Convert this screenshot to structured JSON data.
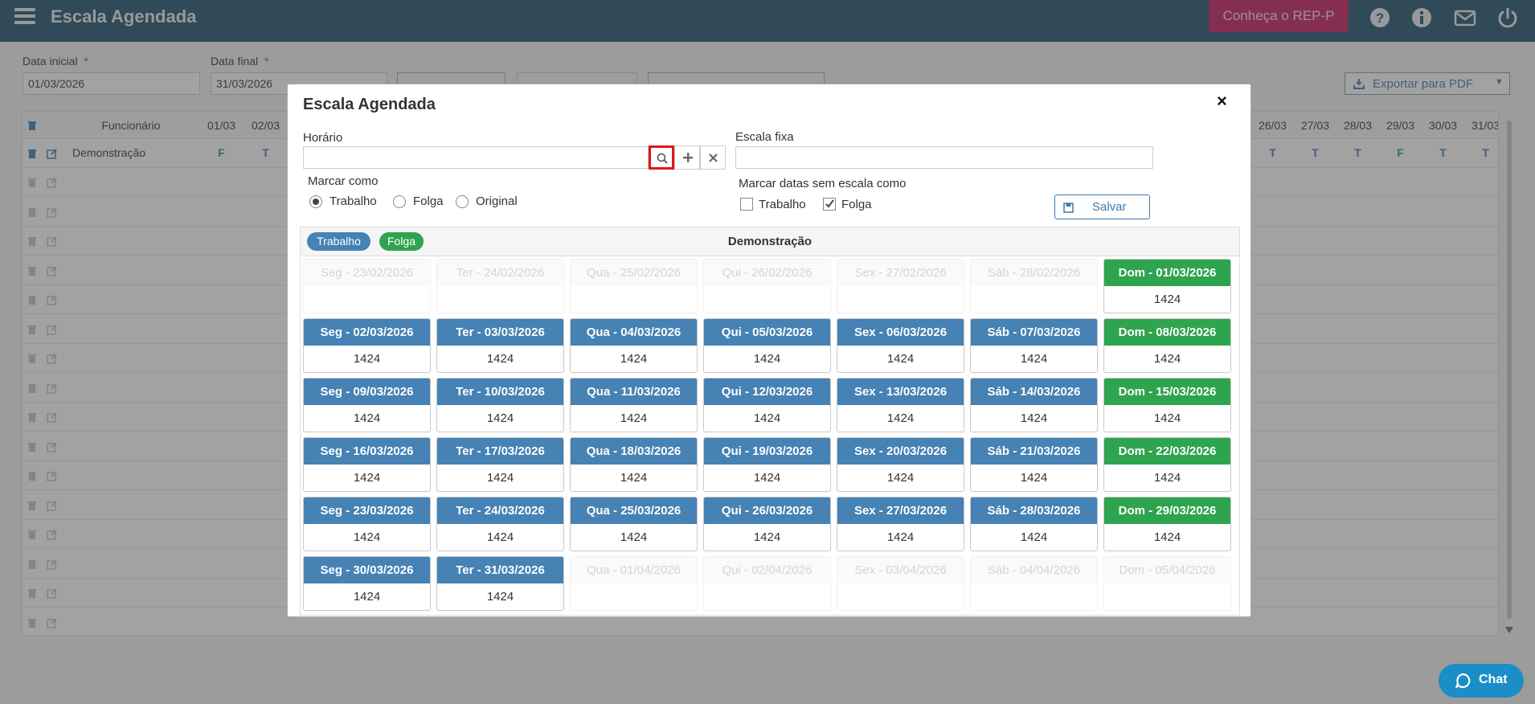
{
  "app": {
    "title": "Escala Agendada",
    "rep_button": "Conheça o REP-P"
  },
  "filters": {
    "start_label": "Data inicial",
    "start_value": "01/03/2026",
    "end_label": "Data final",
    "end_value": "31/03/2026",
    "required_mark": "*",
    "export_label": "Exportar para PDF"
  },
  "grid": {
    "header": {
      "employee": "Funcionário",
      "dates_left": [
        "01/03",
        "02/03"
      ],
      "dates_right": [
        "26/03",
        "27/03",
        "28/03",
        "29/03",
        "30/03",
        "31/03"
      ]
    },
    "row": {
      "employee": "Demonstração",
      "marks_left": [
        "F",
        "T"
      ],
      "marks_right": [
        "T",
        "T",
        "T",
        "F",
        "T",
        "T"
      ]
    }
  },
  "modal": {
    "title": "Escala Agendada",
    "close": "×",
    "horario_label": "Horário",
    "horario_value": "",
    "escala_fixa_label": "Escala fixa",
    "escala_fixa_value": "",
    "marcar_como_label": "Marcar como",
    "marcar_como_options": [
      "Trabalho",
      "Folga",
      "Original"
    ],
    "marcar_como_selected": "Trabalho",
    "marcar_sem_escala_label": "Marcar datas sem escala como",
    "sem_escala_options": [
      {
        "label": "Trabalho",
        "checked": false
      },
      {
        "label": "Folga",
        "checked": true
      }
    ],
    "save_label": "Salvar",
    "legend": {
      "work": "Trabalho",
      "off": "Folga",
      "work_color": "#4682b4",
      "off_color": "#2fa44f"
    },
    "employee_name": "Demonstração",
    "calendar": [
      [
        {
          "label": "Seg - 23/02/2026",
          "value": "",
          "state": "ghost"
        },
        {
          "label": "Ter - 24/02/2026",
          "value": "",
          "state": "ghost"
        },
        {
          "label": "Qua - 25/02/2026",
          "value": "",
          "state": "ghost"
        },
        {
          "label": "Qui - 26/02/2026",
          "value": "",
          "state": "ghost"
        },
        {
          "label": "Sex - 27/02/2026",
          "value": "",
          "state": "ghost"
        },
        {
          "label": "Sáb - 28/02/2026",
          "value": "",
          "state": "ghost"
        },
        {
          "label": "Dom - 01/03/2026",
          "value": "1424",
          "state": "sun"
        }
      ],
      [
        {
          "label": "Seg - 02/03/2026",
          "value": "1424",
          "state": "work"
        },
        {
          "label": "Ter - 03/03/2026",
          "value": "1424",
          "state": "work"
        },
        {
          "label": "Qua - 04/03/2026",
          "value": "1424",
          "state": "work"
        },
        {
          "label": "Qui - 05/03/2026",
          "value": "1424",
          "state": "work"
        },
        {
          "label": "Sex - 06/03/2026",
          "value": "1424",
          "state": "work"
        },
        {
          "label": "Sáb - 07/03/2026",
          "value": "1424",
          "state": "work"
        },
        {
          "label": "Dom - 08/03/2026",
          "value": "1424",
          "state": "sun"
        }
      ],
      [
        {
          "label": "Seg - 09/03/2026",
          "value": "1424",
          "state": "work"
        },
        {
          "label": "Ter - 10/03/2026",
          "value": "1424",
          "state": "work"
        },
        {
          "label": "Qua - 11/03/2026",
          "value": "1424",
          "state": "work"
        },
        {
          "label": "Qui - 12/03/2026",
          "value": "1424",
          "state": "work"
        },
        {
          "label": "Sex - 13/03/2026",
          "value": "1424",
          "state": "work"
        },
        {
          "label": "Sáb - 14/03/2026",
          "value": "1424",
          "state": "work"
        },
        {
          "label": "Dom - 15/03/2026",
          "value": "1424",
          "state": "sun"
        }
      ],
      [
        {
          "label": "Seg - 16/03/2026",
          "value": "1424",
          "state": "work"
        },
        {
          "label": "Ter - 17/03/2026",
          "value": "1424",
          "state": "work"
        },
        {
          "label": "Qua - 18/03/2026",
          "value": "1424",
          "state": "work"
        },
        {
          "label": "Qui - 19/03/2026",
          "value": "1424",
          "state": "work"
        },
        {
          "label": "Sex - 20/03/2026",
          "value": "1424",
          "state": "work"
        },
        {
          "label": "Sáb - 21/03/2026",
          "value": "1424",
          "state": "work"
        },
        {
          "label": "Dom - 22/03/2026",
          "value": "1424",
          "state": "sun"
        }
      ],
      [
        {
          "label": "Seg - 23/03/2026",
          "value": "1424",
          "state": "work"
        },
        {
          "label": "Ter - 24/03/2026",
          "value": "1424",
          "state": "work"
        },
        {
          "label": "Qua - 25/03/2026",
          "value": "1424",
          "state": "work"
        },
        {
          "label": "Qui - 26/03/2026",
          "value": "1424",
          "state": "work"
        },
        {
          "label": "Sex - 27/03/2026",
          "value": "1424",
          "state": "work"
        },
        {
          "label": "Sáb - 28/03/2026",
          "value": "1424",
          "state": "work"
        },
        {
          "label": "Dom - 29/03/2026",
          "value": "1424",
          "state": "sun"
        }
      ],
      [
        {
          "label": "Seg - 30/03/2026",
          "value": "1424",
          "state": "work"
        },
        {
          "label": "Ter - 31/03/2026",
          "value": "1424",
          "state": "work"
        },
        {
          "label": "Qua - 01/04/2026",
          "value": "",
          "state": "ghost"
        },
        {
          "label": "Qui - 02/04/2026",
          "value": "",
          "state": "ghost"
        },
        {
          "label": "Sex - 03/04/2026",
          "value": "",
          "state": "ghost"
        },
        {
          "label": "Sáb - 04/04/2026",
          "value": "",
          "state": "ghost"
        },
        {
          "label": "Dom - 05/04/2026",
          "value": "",
          "state": "ghost"
        }
      ]
    ]
  },
  "chat": {
    "label": "Chat"
  }
}
